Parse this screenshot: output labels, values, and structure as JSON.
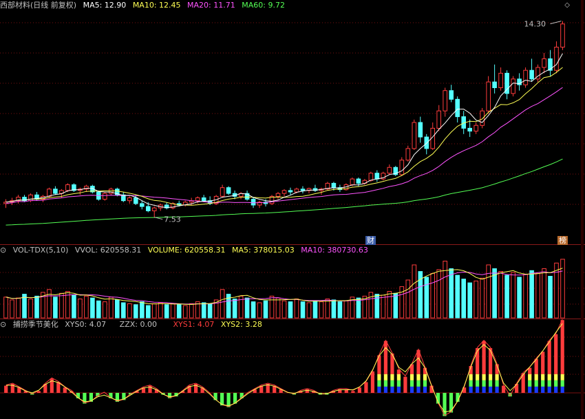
{
  "main": {
    "title": "西部材料(日线 前复权)",
    "ma5_label": "MA5: 12.90",
    "ma10_label": "MA10: 12.45",
    "ma20_label": "MA20: 11.71",
    "ma60_label": "MA60: 9.72",
    "high_label": "14.30",
    "low_label": "7.53",
    "badges": {
      "cai": "财",
      "bang": "榜"
    },
    "icons": {
      "corner": "diamond-icon",
      "close": "circle-icon"
    }
  },
  "volume": {
    "title": "VOL-TDX(5,10)",
    "vvol_label": "VVOL: 620558.31",
    "volume_label": "VOLUME: 620558.31",
    "ma5_label": "MA5: 378015.03",
    "ma10_label": "MA10: 380730.63"
  },
  "indicator": {
    "title": "捕捞季节美化",
    "xys0_label": "XYS0: 4.07",
    "zzx_label": "ZZX: 0.00",
    "xys1_label": "XYS1: 4.07",
    "xys2_label": "XYS2: 3.28"
  },
  "colors": {
    "up": "#ff3c3c",
    "down": "#54ffff",
    "ma5": "#ffffff",
    "ma10": "#ffff54",
    "ma20": "#ff54ff",
    "ma60": "#54ff54",
    "grid": "#7a1010",
    "text": "#c0c0c0"
  },
  "chart_data": [
    {
      "type": "candlestick",
      "title": "西部材料(日线 前复权)",
      "ylim": [
        7.0,
        14.6
      ],
      "annotations": [
        {
          "label": "14.30",
          "value": 14.3
        },
        {
          "label": "7.53",
          "value": 7.53
        }
      ],
      "candles": [
        [
          8.0,
          8.15,
          7.85,
          8.05
        ],
        [
          8.05,
          8.2,
          7.95,
          8.1
        ],
        [
          8.1,
          8.3,
          8.0,
          8.22
        ],
        [
          8.22,
          8.3,
          8.05,
          8.1
        ],
        [
          8.1,
          8.35,
          8.05,
          8.3
        ],
        [
          8.3,
          8.4,
          8.1,
          8.15
        ],
        [
          8.15,
          8.3,
          8.05,
          8.25
        ],
        [
          8.25,
          8.55,
          8.2,
          8.5
        ],
        [
          8.5,
          8.6,
          8.3,
          8.35
        ],
        [
          8.35,
          8.5,
          8.2,
          8.45
        ],
        [
          8.45,
          8.7,
          8.4,
          8.65
        ],
        [
          8.65,
          8.7,
          8.4,
          8.45
        ],
        [
          8.45,
          8.55,
          8.3,
          8.5
        ],
        [
          8.5,
          8.65,
          8.4,
          8.6
        ],
        [
          8.6,
          8.65,
          8.35,
          8.4
        ],
        [
          8.4,
          8.45,
          8.1,
          8.15
        ],
        [
          8.15,
          8.4,
          8.1,
          8.35
        ],
        [
          8.35,
          8.55,
          8.3,
          8.5
        ],
        [
          8.5,
          8.55,
          8.25,
          8.3
        ],
        [
          8.3,
          8.4,
          8.05,
          8.1
        ],
        [
          8.1,
          8.25,
          8.0,
          8.2
        ],
        [
          8.2,
          8.3,
          7.95,
          8.0
        ],
        [
          8.0,
          8.1,
          7.8,
          7.9
        ],
        [
          7.9,
          8.05,
          7.7,
          7.75
        ],
        [
          7.75,
          7.9,
          7.53,
          7.85
        ],
        [
          7.85,
          8.0,
          7.75,
          7.95
        ],
        [
          7.95,
          8.05,
          7.8,
          7.85
        ],
        [
          7.85,
          8.05,
          7.8,
          8.0
        ],
        [
          8.0,
          8.1,
          7.9,
          7.95
        ],
        [
          7.95,
          8.1,
          7.9,
          8.05
        ],
        [
          8.05,
          8.2,
          7.95,
          8.1
        ],
        [
          8.1,
          8.25,
          8.0,
          8.2
        ],
        [
          8.2,
          8.3,
          8.05,
          8.1
        ],
        [
          8.1,
          8.25,
          7.95,
          8.0
        ],
        [
          8.0,
          8.3,
          7.95,
          8.25
        ],
        [
          8.25,
          8.65,
          8.2,
          8.55
        ],
        [
          8.55,
          8.6,
          8.3,
          8.35
        ],
        [
          8.35,
          8.45,
          8.15,
          8.25
        ],
        [
          8.25,
          8.4,
          8.15,
          8.35
        ],
        [
          8.35,
          8.45,
          8.1,
          8.15
        ],
        [
          8.15,
          8.2,
          7.85,
          7.95
        ],
        [
          7.95,
          8.1,
          7.85,
          8.05
        ],
        [
          8.05,
          8.15,
          7.9,
          8.0
        ],
        [
          8.0,
          8.3,
          7.95,
          8.25
        ],
        [
          8.25,
          8.4,
          8.15,
          8.35
        ],
        [
          8.35,
          8.5,
          8.25,
          8.45
        ],
        [
          8.45,
          8.55,
          8.3,
          8.4
        ],
        [
          8.4,
          8.55,
          8.35,
          8.5
        ],
        [
          8.5,
          8.6,
          8.35,
          8.45
        ],
        [
          8.45,
          8.55,
          8.35,
          8.52
        ],
        [
          8.52,
          8.65,
          8.4,
          8.45
        ],
        [
          8.45,
          8.55,
          8.3,
          8.5
        ],
        [
          8.5,
          8.75,
          8.45,
          8.7
        ],
        [
          8.7,
          8.75,
          8.45,
          8.55
        ],
        [
          8.55,
          8.65,
          8.4,
          8.48
        ],
        [
          8.48,
          8.7,
          8.45,
          8.65
        ],
        [
          8.65,
          8.9,
          8.6,
          8.85
        ],
        [
          8.85,
          8.9,
          8.6,
          8.7
        ],
        [
          8.7,
          8.85,
          8.65,
          8.8
        ],
        [
          8.8,
          9.1,
          8.75,
          9.05
        ],
        [
          9.05,
          9.15,
          8.75,
          8.85
        ],
        [
          8.85,
          9.1,
          8.8,
          9.05
        ],
        [
          9.05,
          9.35,
          9.0,
          9.25
        ],
        [
          9.25,
          9.3,
          8.95,
          9.0
        ],
        [
          9.0,
          9.6,
          8.95,
          9.5
        ],
        [
          9.5,
          10.0,
          9.45,
          9.9
        ],
        [
          9.9,
          10.9,
          9.85,
          10.8
        ],
        [
          10.8,
          11.0,
          10.1,
          10.3
        ],
        [
          10.3,
          10.4,
          9.7,
          9.9
        ],
        [
          9.9,
          10.8,
          9.85,
          10.6
        ],
        [
          10.6,
          11.4,
          10.5,
          11.2
        ],
        [
          11.2,
          12.0,
          11.0,
          11.9
        ],
        [
          11.9,
          12.1,
          11.5,
          11.6
        ],
        [
          11.6,
          11.7,
          10.8,
          11.0
        ],
        [
          11.0,
          11.2,
          10.4,
          10.6
        ],
        [
          10.6,
          10.9,
          10.3,
          10.5
        ],
        [
          10.5,
          10.8,
          10.4,
          10.7
        ],
        [
          10.7,
          11.3,
          10.6,
          11.2
        ],
        [
          11.2,
          12.4,
          11.1,
          12.2
        ],
        [
          12.2,
          12.8,
          11.8,
          12.0
        ],
        [
          12.0,
          12.7,
          11.9,
          12.5
        ],
        [
          12.5,
          12.6,
          11.6,
          11.8
        ],
        [
          11.8,
          12.4,
          11.7,
          12.3
        ],
        [
          12.3,
          12.5,
          11.9,
          12.1
        ],
        [
          12.1,
          12.7,
          12.0,
          12.6
        ],
        [
          12.6,
          13.0,
          12.2,
          12.3
        ],
        [
          12.3,
          12.8,
          12.2,
          12.7
        ],
        [
          12.7,
          13.2,
          12.5,
          13.0
        ],
        [
          13.0,
          13.3,
          12.4,
          12.6
        ],
        [
          12.6,
          13.6,
          12.5,
          13.4
        ],
        [
          13.4,
          14.3,
          13.3,
          14.2
        ]
      ]
    },
    {
      "type": "bar",
      "title": "VOL-TDX(5,10)",
      "values": [
        220,
        190,
        210,
        250,
        200,
        230,
        270,
        300,
        220,
        260,
        280,
        240,
        200,
        230,
        210,
        180,
        170,
        220,
        190,
        160,
        150,
        140,
        170,
        130,
        150,
        160,
        140,
        150,
        140,
        130,
        150,
        170,
        160,
        150,
        190,
        300,
        250,
        200,
        230,
        210,
        170,
        160,
        180,
        230,
        210,
        180,
        170,
        200,
        170,
        160,
        180,
        170,
        200,
        190,
        170,
        180,
        220,
        210,
        230,
        270,
        250,
        240,
        280,
        260,
        330,
        400,
        560,
        490,
        430,
        470,
        510,
        600,
        520,
        450,
        410,
        370,
        390,
        420,
        560,
        520,
        490,
        450,
        480,
        430,
        460,
        500,
        470,
        520,
        440,
        580,
        620
      ],
      "ma5_label": "MA5: 378015.03",
      "ma10_label": "MA10: 380730.63"
    },
    {
      "type": "bar",
      "title": "捕捞季节美化",
      "values": [
        0.4,
        0.5,
        0.3,
        0.1,
        -0.1,
        0.1,
        0.5,
        0.8,
        0.6,
        0.3,
        0.1,
        -0.3,
        -0.6,
        -0.5,
        -0.2,
        0.0,
        -0.3,
        -0.5,
        -0.4,
        -0.1,
        0.1,
        0.3,
        0.4,
        0.2,
        -0.1,
        -0.3,
        -0.2,
        0.1,
        0.4,
        0.5,
        0.3,
        0.0,
        -0.4,
        -0.7,
        -0.8,
        -0.6,
        -0.3,
        0.0,
        0.2,
        0.4,
        0.5,
        0.4,
        0.2,
        0.0,
        -0.1,
        0.1,
        0.2,
        0.1,
        -0.1,
        -0.1,
        0.1,
        0.2,
        0.2,
        0.1,
        0.3,
        0.6,
        1.2,
        2.1,
        2.9,
        2.2,
        1.3,
        0.9,
        1.6,
        2.4,
        1.4,
        0.4,
        -0.6,
        -1.3,
        -1.1,
        -0.5,
        0.3,
        1.5,
        2.5,
        2.9,
        2.5,
        1.6,
        0.4,
        -0.2,
        0.5,
        1.1,
        1.4,
        1.9,
        2.3,
        2.9,
        3.28,
        4.07
      ],
      "xys0_label": "XYS0: 4.07",
      "zzx_label": "ZZX: 0.00",
      "xys1_label": "XYS1: 4.07",
      "xys2_label": "XYS2: 3.28"
    }
  ]
}
